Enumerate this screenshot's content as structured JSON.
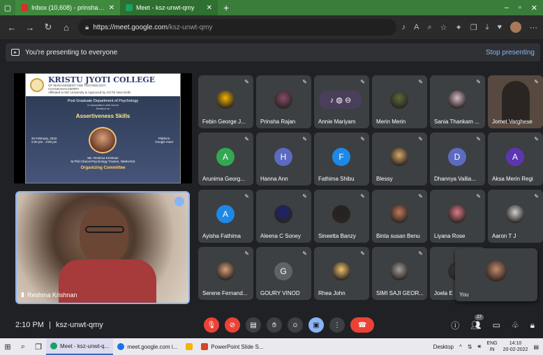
{
  "browser": {
    "tabs": [
      {
        "label": "Inbox (10,608) - prinsharajan28@",
        "active": false,
        "color": "#d93025"
      },
      {
        "label": "Meet - ksz-unwt-qmy",
        "active": true,
        "color": "#1aa260"
      }
    ],
    "new_tab": "+",
    "address": {
      "host": "https://meet.google.com",
      "path": "/ksz-unwt-qmy"
    }
  },
  "banner": {
    "text": "You're presenting to everyone",
    "stop_label": "Stop presenting"
  },
  "slide": {
    "college": "KRISTU JYOTI COLLEGE",
    "college_sub": "OF MANAGEMENT AND TECHNOLOGY",
    "location": "CHANGANACHERRY",
    "affiliation": "Affiliated to MG University & Approved by AICTE New Delhi",
    "dept": "Post Graduate Department of Psychology",
    "series": "in Association with Guest",
    "session_on": "Session on",
    "title": "Assertiveness Skills",
    "date": "20 February, 2022",
    "time": "2:00 pm - 3:00 pm",
    "platform_label": "Platform",
    "platform": "Google meet",
    "speaker": "Ms. Reshma Krishnan",
    "speaker_role": "M.Phil Clinical Psychology Trainee, NIMHANS",
    "organizing": "Organizing Committee"
  },
  "self": {
    "name": "Reshma Krishnan"
  },
  "participants": [
    {
      "name": "Febin George J...",
      "type": "photo",
      "color": "#f4b400",
      "initial": ""
    },
    {
      "name": "Prinsha Rajan",
      "type": "photo",
      "color": "#8a4b6b",
      "initial": ""
    },
    {
      "name": "Annie Mariyam",
      "type": "speaking",
      "color": "#3c4043",
      "initial": ""
    },
    {
      "name": "Merin Merin",
      "type": "photo",
      "color": "#5a6b3a",
      "initial": ""
    },
    {
      "name": "Sania Thankam ...",
      "type": "photo",
      "color": "#d9b9c9",
      "initial": ""
    },
    {
      "name": "Jomet Varghese",
      "type": "video",
      "color": "#57493f",
      "initial": ""
    },
    {
      "name": "Arunima Georg...",
      "type": "initial",
      "color": "#33a852",
      "initial": "A"
    },
    {
      "name": "Hanna Ann",
      "type": "initial",
      "color": "#5c6bc0",
      "initial": "H"
    },
    {
      "name": "Fathima Shibu",
      "type": "initial",
      "color": "#1e88e5",
      "initial": "F"
    },
    {
      "name": "Blessy",
      "type": "photo",
      "color": "#d9a86b",
      "initial": ""
    },
    {
      "name": "Dhannya Vallia...",
      "type": "initial",
      "color": "#5c6bc0",
      "initial": "D"
    },
    {
      "name": "Aksa Merin Regi",
      "type": "initial",
      "color": "#5e35b1",
      "initial": "A"
    },
    {
      "name": "Ayisha Fathima",
      "type": "initial",
      "color": "#1e88e5",
      "initial": "A"
    },
    {
      "name": "Aleena C Soney",
      "type": "photo",
      "color": "#1a237e",
      "initial": ""
    },
    {
      "name": "Sineetta Banzy",
      "type": "photo",
      "color": "#222222",
      "initial": ""
    },
    {
      "name": "Binta susan Benu",
      "type": "photo",
      "color": "#c27a5a",
      "initial": ""
    },
    {
      "name": "Liyana Rose",
      "type": "photo",
      "color": "#e07a8a",
      "initial": ""
    },
    {
      "name": "Aaron T J",
      "type": "photo",
      "color": "#cfcfcf",
      "initial": ""
    },
    {
      "name": "Serene Fernand...",
      "type": "photo",
      "color": "#d7a07a",
      "initial": ""
    },
    {
      "name": "GOURY VINOD",
      "type": "initial",
      "color": "#5f6368",
      "initial": "G"
    },
    {
      "name": "Rhea John",
      "type": "photo",
      "color": "#f0c36c",
      "initial": ""
    },
    {
      "name": "SIMI SAJI GEOR...",
      "type": "photo",
      "color": "#a0a0a0",
      "initial": ""
    },
    {
      "name": "Joela E",
      "type": "photo",
      "color": "#3c4043",
      "initial": ""
    }
  ],
  "you": {
    "name": "You"
  },
  "meetbar": {
    "time": "2:10 PM",
    "separator": "|",
    "code": "ksz-unwt-qmy",
    "participants_count": "27"
  },
  "taskbar": {
    "apps": [
      {
        "label": "Meet - ksz-unwt-q...",
        "color": "#1aa260",
        "active": true
      },
      {
        "label": "meet.google.com i...",
        "color": "#1a73e8",
        "active": false
      },
      {
        "label": "",
        "color": "#f4b400",
        "active": false
      },
      {
        "label": "PowerPoint Slide S...",
        "color": "#d24726",
        "active": false
      }
    ],
    "desktop": "Desktop",
    "lang": "ENG",
    "lang_sub": "IN",
    "clock_time": "14:10",
    "clock_date": "20-02-2022"
  }
}
